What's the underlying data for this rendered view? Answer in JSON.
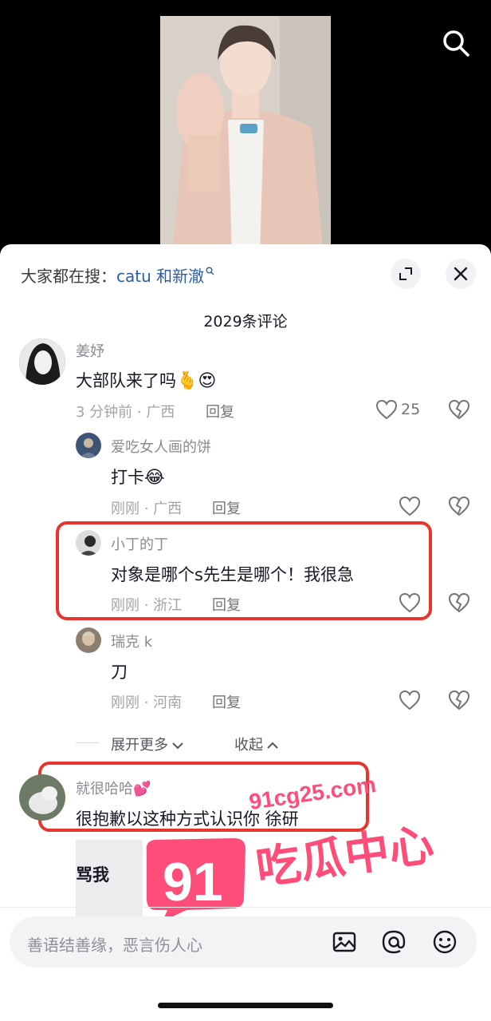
{
  "hot_search": {
    "prefix": "大家都在搜：",
    "query": "catu 和新澈"
  },
  "comment_count": "2029条评论",
  "comments": [
    {
      "user": "姜妤",
      "text": "大部队来了吗",
      "emojis": "🫰😍",
      "time_loc": "3 分钟前 · 广西",
      "reply": "回复",
      "likes": "25"
    },
    {
      "user": "爱吃女人画的饼",
      "text": "打卡",
      "emojis": "😂",
      "time_loc": "刚刚 · 广西",
      "reply": "回复"
    },
    {
      "user": "小丁的丁",
      "text": "对象是哪个s先生是哪个！我很急",
      "time_loc": "刚刚 · 浙江",
      "reply": "回复"
    },
    {
      "user": "瑞克 k",
      "text": "刀",
      "time_loc": "刚刚 · 河南",
      "reply": "回复"
    },
    {
      "user": "就很哈哈",
      "user_emoji": "💕",
      "text": "很抱歉以这种方式认识你 徐研"
    }
  ],
  "expand_more": "展开更多",
  "collapse": "收起",
  "quote_snippet": "骂我",
  "watermark": {
    "domain": "91cg25.com",
    "brand_num": "91",
    "brand_text": "吃瓜中心"
  },
  "input": {
    "placeholder": "善语结善缘，恶言伤人心"
  },
  "colors": {
    "highlight": "#e8342c",
    "link": "#2a5ca8",
    "watermark": "#ff3d6e"
  }
}
